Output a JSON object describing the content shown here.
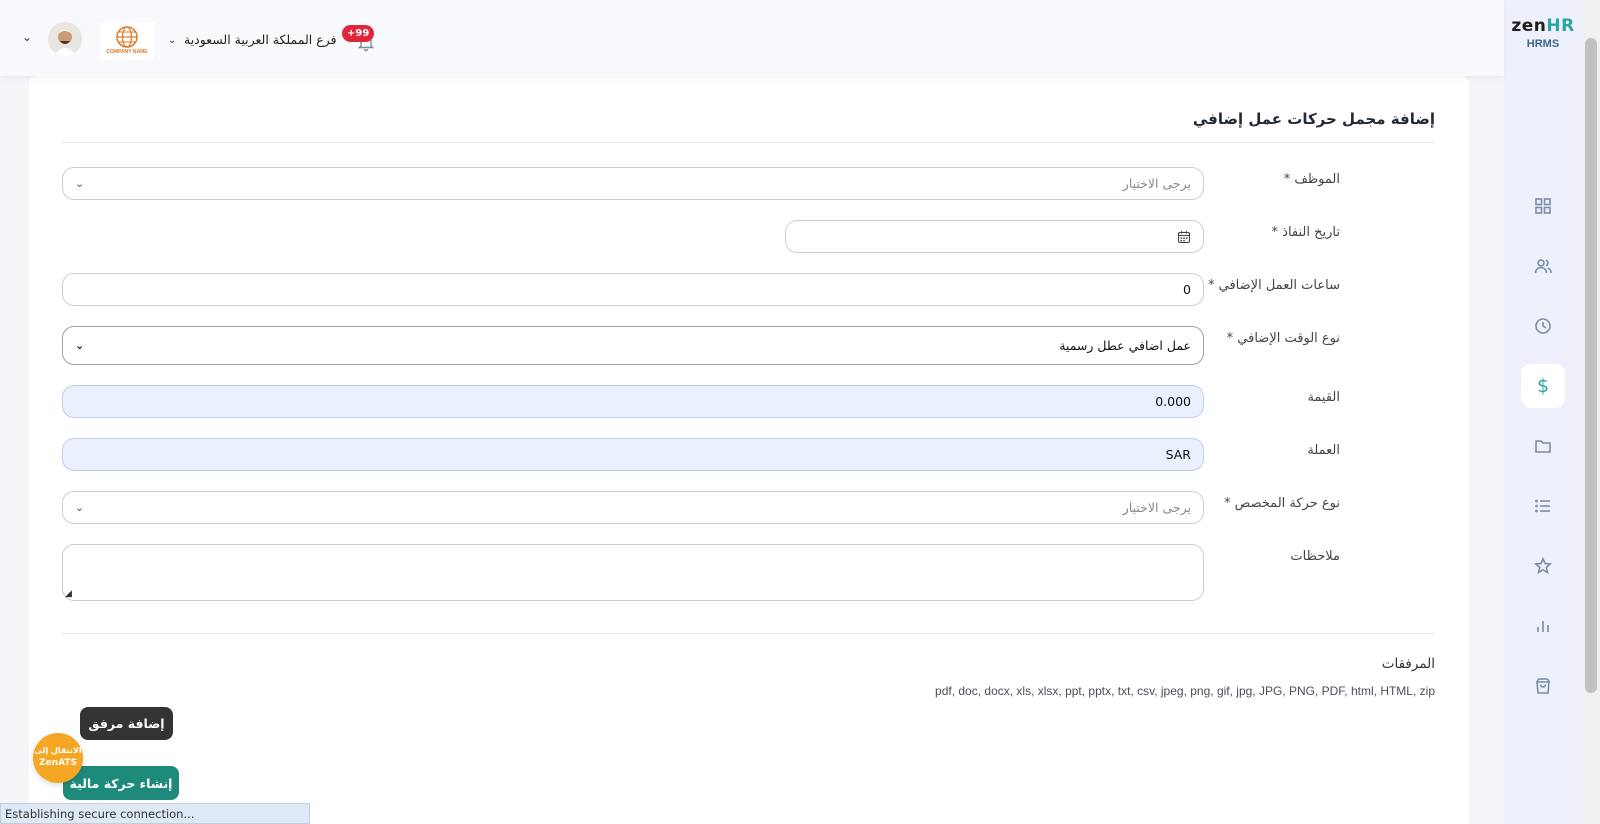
{
  "app": {
    "brand_main": "zen",
    "brand_accent": "HR",
    "brand_sub": "HRMS"
  },
  "colors": {
    "accent": "#2aa5a0",
    "create_button": "#1e8a7b",
    "attach_button": "#333333",
    "badge": "#e0263a",
    "zenats": "#f5a623"
  },
  "header": {
    "branch": "فرع المملكة العربية السعودية",
    "notifications_badge": "+99",
    "company_logo_text": "COMPANY NAME"
  },
  "nav": {
    "items": [
      {
        "icon": "dashboard-icon"
      },
      {
        "icon": "users-icon"
      },
      {
        "icon": "clock-icon"
      },
      {
        "icon": "dollar-icon",
        "symbol": "$",
        "active": true
      },
      {
        "icon": "folder-icon"
      },
      {
        "icon": "list-icon"
      },
      {
        "icon": "star-icon"
      },
      {
        "icon": "bar-chart-icon"
      },
      {
        "icon": "shopping-bag-icon"
      }
    ]
  },
  "form": {
    "title": "إضافة مجمل حركات عمل إضافي",
    "employee": {
      "label": "الموظف *",
      "placeholder": "يرجى الاختيار"
    },
    "effective_date": {
      "label": "تاريخ النفاذ *",
      "value": ""
    },
    "overtime_hours": {
      "label": "ساعات العمل الإضافي *",
      "value": "0"
    },
    "overtime_type": {
      "label": "نوع الوقت الإضافي *",
      "value": "عمل اضافي عطل رسمية"
    },
    "amount": {
      "label": "القيمة",
      "value": "0.000"
    },
    "currency": {
      "label": "العملة",
      "value": "SAR"
    },
    "allocation_type": {
      "label": "نوع حركة المخصص *",
      "placeholder": "يرجى الاختيار"
    },
    "notes": {
      "label": "ملاحظات",
      "value": ""
    },
    "attachments": {
      "title": "المرفقات",
      "extensions": "pdf, doc, docx, xls, xlsx, ppt, pptx, txt, csv, jpeg, png, gif, jpg, JPG, PNG, PDF, html, HTML, zip"
    },
    "add_attachment_label": "إضافة مرفق",
    "submit_label": "إنشاء حركة مالية"
  },
  "zenats": {
    "line1": "الانتقال إلى",
    "line2": "ZenATS"
  },
  "status_bar": "Establishing secure connection..."
}
